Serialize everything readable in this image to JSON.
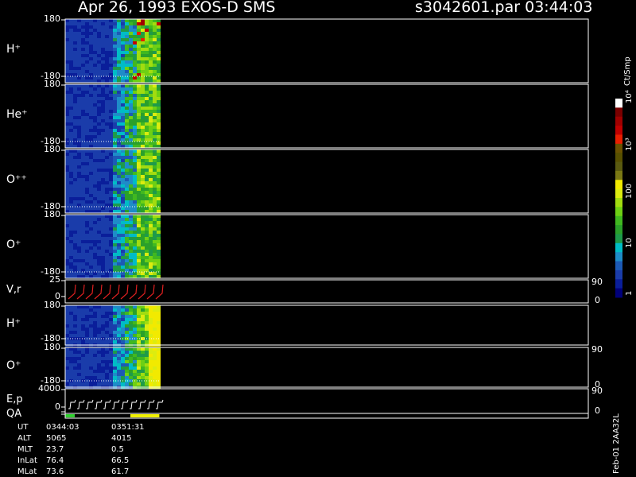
{
  "header": {
    "title": "Apr 26, 1993   EXOS-D SMS",
    "file_time": "s3042601.par  03:44:03"
  },
  "colorbar": {
    "unit_label": "Ct/Smp",
    "tick_labels": [
      "1",
      "10",
      "100",
      "10³",
      "10⁴"
    ],
    "colors": [
      "#00007a",
      "#0a1e9a",
      "#1a3caa",
      "#1c5ab5",
      "#1e8cc8",
      "#00bcc6",
      "#1e9a4a",
      "#2aa02a",
      "#40b820",
      "#6ed014",
      "#a2dc10",
      "#dcec10",
      "#f2ea00",
      "#7a7814",
      "#5a5a10",
      "#585000",
      "#6a5200",
      "#e81e00",
      "#c00000",
      "#a00000",
      "#7a0000",
      "#ffffff"
    ]
  },
  "series_colors": {
    "velocity": "#e02020",
    "energy": "#ffffff",
    "qa_green": "#30d030",
    "qa_yellow": "#f0f000"
  },
  "chart_data": {
    "type": "heatmap",
    "data_fill_fraction": 0.18,
    "panels": [
      {
        "id": "h-plus",
        "label": "H⁺",
        "ymax_label": "180",
        "ymin_label": "-180",
        "ylim": [
          -180,
          180
        ]
      },
      {
        "id": "he-plus",
        "label": "He⁺",
        "ymax_label": "180",
        "ymin_label": "-180",
        "ylim": [
          -180,
          180
        ]
      },
      {
        "id": "o-pp",
        "label": "O⁺⁺",
        "ymax_label": "180",
        "ymin_label": "-180",
        "ylim": [
          -180,
          180
        ]
      },
      {
        "id": "o-plus",
        "label": "O⁺",
        "ymax_label": "180",
        "ymin_label": "-180",
        "ylim": [
          -180,
          180
        ]
      },
      {
        "id": "vr",
        "label": "V,r",
        "ymax_label": "25",
        "ymin_label": "0",
        "right_top": "90",
        "right_bottom": "0",
        "ylim": [
          0,
          25
        ]
      },
      {
        "id": "h-plus-2",
        "label": "H⁺",
        "ymax_label": "180",
        "ymin_label": "-180",
        "ylim": [
          -180,
          180
        ]
      },
      {
        "id": "o-plus-2",
        "label": "O⁺",
        "ymax_label": "180",
        "ymin_label": "-180",
        "right_top": "90",
        "right_bottom": "0",
        "ylim": [
          -180,
          180
        ]
      },
      {
        "id": "ep",
        "label": "E,p",
        "ymax_label": "4000",
        "ymin_label": "0",
        "right_top": "90",
        "right_bottom": "0",
        "ylim": [
          0,
          4000
        ]
      },
      {
        "id": "qa",
        "label": "QA"
      }
    ]
  },
  "footer": {
    "rows": [
      {
        "name": "UT",
        "v1": "0344:03",
        "v2": "0351:31"
      },
      {
        "name": "ALT",
        "v1": "5065",
        "v2": "4015"
      },
      {
        "name": "MLT",
        "v1": "23.7",
        "v2": "0.5"
      },
      {
        "name": "InLat",
        "v1": "76.4",
        "v2": "66.5"
      },
      {
        "name": "MLat",
        "v1": "73.6",
        "v2": "61.7"
      }
    ],
    "version": "Feb-01 2AA32L"
  }
}
